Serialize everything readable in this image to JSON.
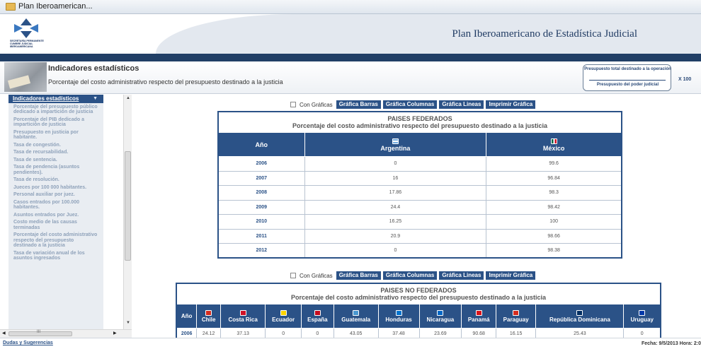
{
  "window": {
    "title": "Plan Iberoamerican..."
  },
  "header": {
    "logo_text": "SECRETARÍA PERMANENTE CUMBRE JUDICIAL IBEROAMERICANA",
    "app_title": "Plan Iberoamericano de Estadística Judicial"
  },
  "section": {
    "title": "Indicadores estadísticos",
    "subtitle": "Porcentaje del costo administrativo respecto del presupuesto destinado a la justicia",
    "formula_numerator": "Presupuesto total destinado a la operación",
    "formula_denominator": "Presupuesto del poder judicial",
    "formula_multiplier": "X 100"
  },
  "sidebar": {
    "header": "Indicadores estadísticos",
    "items": [
      "Porcentaje del presupuesto público dedicado a impartición de justicia",
      "Porcentaje del PIB dedicado a impartición de justicia",
      "Presupuesto en justicia por habitante.",
      "Tasa de congestión.",
      "Tasa de recursabilidad.",
      "Tasa de sentencia.",
      "Tasa de pendencia (asuntos pendientes).",
      "Tasa de resolución.",
      "Jueces por 100 000 habitantes.",
      "Personal auxiliar por juez.",
      "Casos entrados por 100.000 habitantes.",
      "Asuntos entrados por Juez.",
      "Costo medio de las causas terminadas",
      "Porcentaje del costo administrativo respecto del presupuesto destinado a la justicia",
      "Tasa de variación anual de los asuntos ingresados"
    ]
  },
  "toolbar": {
    "checkbox_label": "Con Gráficas",
    "bars": "Gráfica Barras",
    "columns": "Gráfica Columnas",
    "lines": "Gráfica Lineas",
    "print": "Imprimir Gráfica"
  },
  "table1": {
    "caption1": "PAISES FEDERADOS",
    "caption2": "Porcentaje del costo administrativo respecto del presupuesto destinado a la justicia",
    "col_year": "Año",
    "countries": [
      {
        "name": "Argentina",
        "flag_color": "#74acdf"
      },
      {
        "name": "México",
        "flag_color": "#006847"
      }
    ],
    "rows": [
      {
        "year": "2006",
        "values": [
          "0",
          "99.6"
        ]
      },
      {
        "year": "2007",
        "values": [
          "16",
          "96.84"
        ]
      },
      {
        "year": "2008",
        "values": [
          "17.86",
          "98.3"
        ]
      },
      {
        "year": "2009",
        "values": [
          "24.4",
          "98.42"
        ]
      },
      {
        "year": "2010",
        "values": [
          "16.25",
          "100"
        ]
      },
      {
        "year": "2011",
        "values": [
          "20.9",
          "98.66"
        ]
      },
      {
        "year": "2012",
        "values": [
          "0",
          "98.38"
        ]
      }
    ]
  },
  "table2": {
    "caption1": "PAISES NO FEDERADOS",
    "caption2": "Porcentaje del costo administrativo respecto del presupuesto destinado a la justicia",
    "col_year": "Año",
    "countries": [
      {
        "name": "Chile",
        "flag_color": "#d52b1e"
      },
      {
        "name": "Costa Rica",
        "flag_color": "#ce1126"
      },
      {
        "name": "Ecuador",
        "flag_color": "#ffd100"
      },
      {
        "name": "España",
        "flag_color": "#c60b1e"
      },
      {
        "name": "Guatemala",
        "flag_color": "#4997d0"
      },
      {
        "name": "Honduras",
        "flag_color": "#0073cf"
      },
      {
        "name": "Nicaragua",
        "flag_color": "#0067c6"
      },
      {
        "name": "Panamá",
        "flag_color": "#da121a"
      },
      {
        "name": "Paraguay",
        "flag_color": "#d52b1e"
      },
      {
        "name": "República Dominicana",
        "flag_color": "#002d62"
      },
      {
        "name": "Uruguay",
        "flag_color": "#0038a8"
      }
    ],
    "rows": [
      {
        "year": "2006",
        "values": [
          "24.12",
          "37.13",
          "0",
          "0",
          "43.05",
          "37.48",
          "23.69",
          "90.68",
          "16.15",
          "25.43",
          "0"
        ]
      }
    ]
  },
  "footer": {
    "link": "Dudas y Sugerencias",
    "stamp": "Fecha: 9/5/2013 Hora: 2:0"
  }
}
